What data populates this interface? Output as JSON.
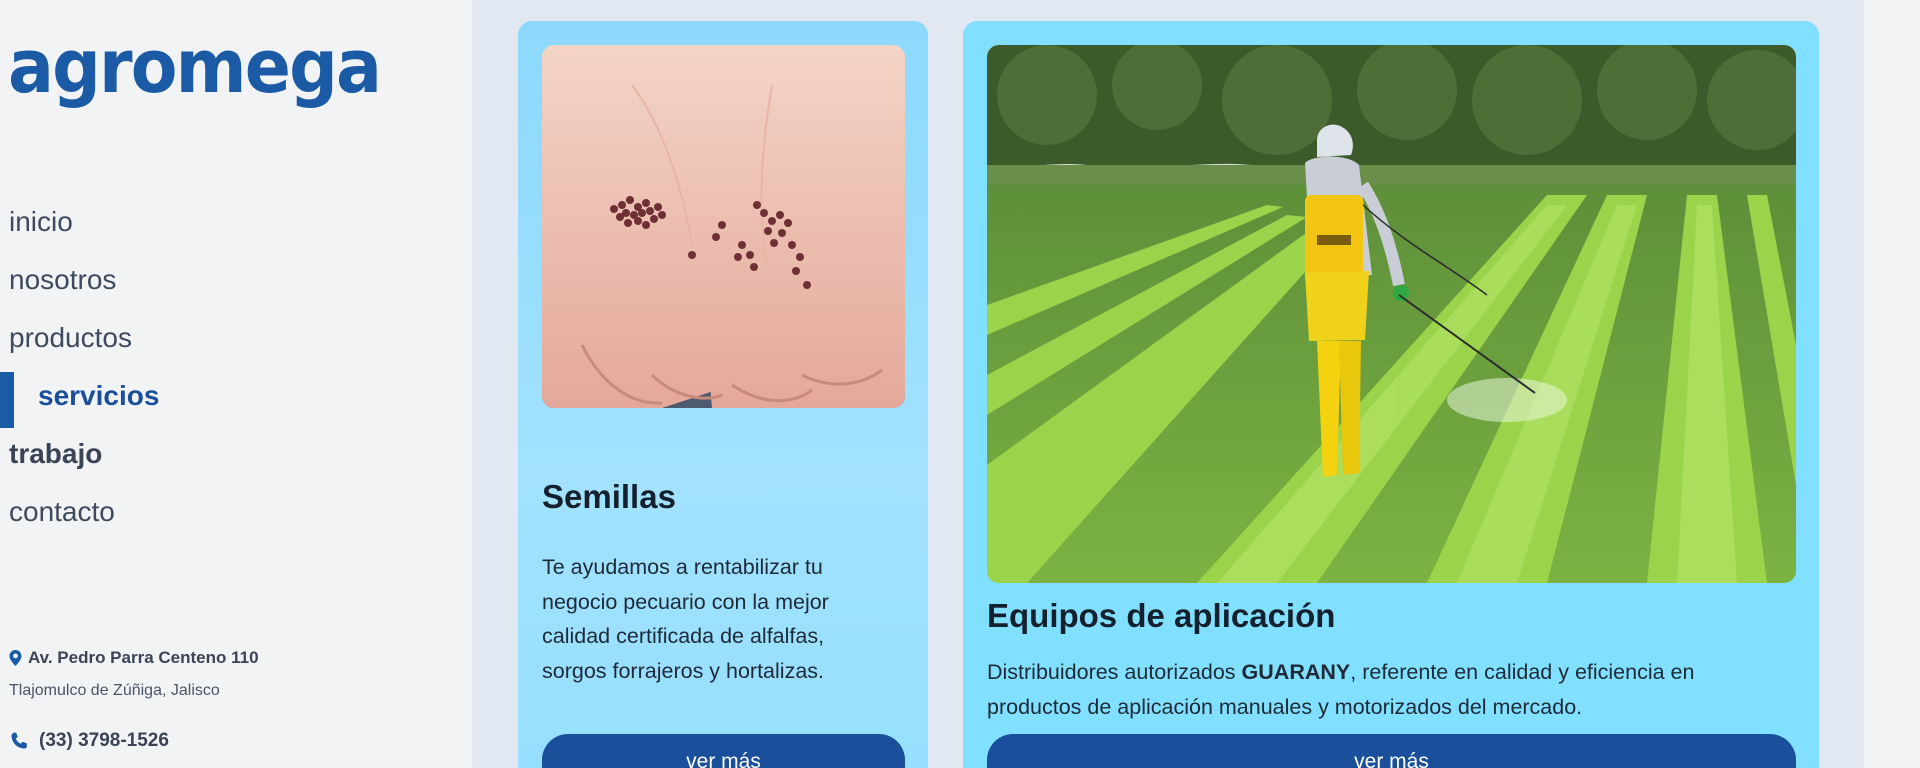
{
  "brand": {
    "logo_text": "agromega",
    "color": "#1b5ba6"
  },
  "nav": {
    "items": [
      {
        "label": "inicio",
        "state": "normal"
      },
      {
        "label": "nosotros",
        "state": "normal"
      },
      {
        "label": "productos",
        "state": "normal"
      },
      {
        "label": "servicios",
        "state": "active"
      },
      {
        "label": "trabajo",
        "state": "bold"
      },
      {
        "label": "contacto",
        "state": "normal"
      }
    ]
  },
  "contact": {
    "address_line1": "Av. Pedro Parra Centeno 110",
    "address_line2": "Tlajomulco de Zúñiga, Jalisco",
    "phone": "(33) 3798-1526",
    "icons": [
      "map-pin-icon",
      "phone-icon"
    ]
  },
  "cards": [
    {
      "title": "Semillas",
      "description": "Te ayudamos a rentabilizar tu negocio pecuario con la mejor calidad certificada de alfalfas, sorgos forrajeros y hortalizas.",
      "button_label": "ver más",
      "image": "hands-holding-seeds-image"
    },
    {
      "title": "Equipos de aplicación",
      "description_before": "Distribuidores autorizados ",
      "description_bold": "GUARANY",
      "description_after": ", referente en calidad y eficiencia en productos de aplicación manuales y motorizados del mercado.",
      "button_label": "ver más",
      "image": "farmer-spraying-lettuce-field-image",
      "sprayer_brand": "GUARANY"
    }
  ],
  "colors": {
    "accent": "#1b5ba6",
    "button": "#1a509b",
    "card_semillas": "#8cd9fd",
    "card_equipos": "#81e0ff",
    "background": "#e2e8f1",
    "sidebar": "#f2f3f5"
  }
}
